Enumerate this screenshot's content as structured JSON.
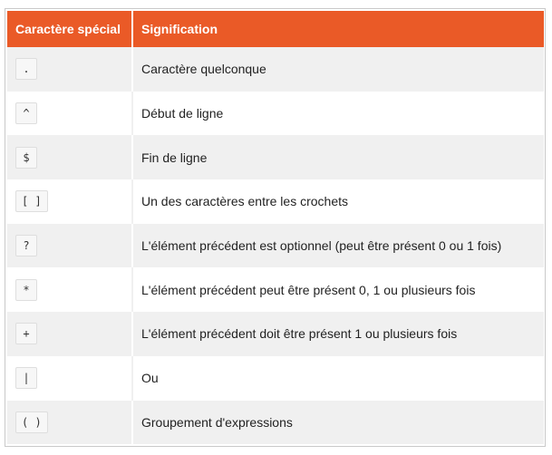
{
  "table": {
    "headers": [
      "Caractère spécial",
      "Signification"
    ],
    "rows": [
      {
        "char": ".",
        "meaning": "Caractère quelconque"
      },
      {
        "char": "^",
        "meaning": "Début de ligne"
      },
      {
        "char": "$",
        "meaning": "Fin de ligne"
      },
      {
        "char": "[ ]",
        "meaning": "Un des caractères entre les crochets"
      },
      {
        "char": "?",
        "meaning": "L'élément précédent est optionnel (peut être présent 0 ou 1 fois)"
      },
      {
        "char": "*",
        "meaning": "L'élément précédent peut être présent 0, 1 ou plusieurs fois"
      },
      {
        "char": "+",
        "meaning": "L'élément précédent doit être présent 1 ou plusieurs fois"
      },
      {
        "char": "|",
        "meaning": "Ou"
      },
      {
        "char": "( )",
        "meaning": "Groupement d'expressions"
      }
    ]
  },
  "colors": {
    "header_bg": "#ea5a27",
    "header_text": "#ffffff",
    "stripe": "#f0f0f0"
  }
}
